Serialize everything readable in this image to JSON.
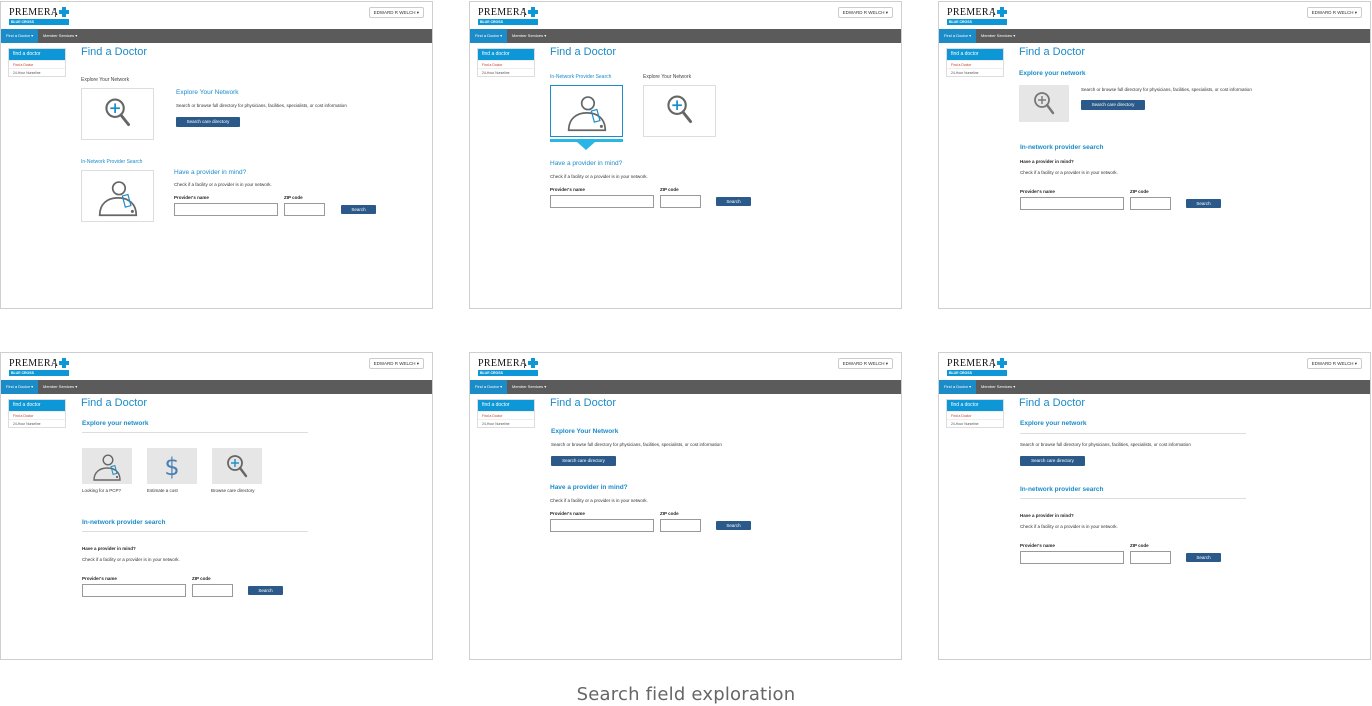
{
  "common": {
    "logo_word": "PREMERA",
    "logo_sub": "BLUE CROSS",
    "user_menu": "EDWARD R WELCH ▾",
    "nav_find_doctor": "Find a Doctor ▾",
    "nav_member_services": "Member Services ▾",
    "side_head": "find a doctor",
    "side_sub_1": "Find a Doctor",
    "side_sub_2": "24-Hour Nurseline",
    "page_title": "Find a Doctor",
    "provider_label": "Provider's name",
    "zip_label": "ZIP code",
    "search_button": "Search",
    "care_dir_button": "Search care directory",
    "have_provider": "Have a provider in mind?",
    "check_text": "Check if a facility or a provider is in your network.",
    "browse_text": "Search or browse full directory for physicians, facilities, specialists, or cost information"
  },
  "frame0": {
    "explore_label": "Explore Your Network",
    "explore_heading": "Explore Your Network",
    "innetwork_label": "In-Network Provider Search"
  },
  "frame1": {
    "innetwork_label": "In-Network Provider Search",
    "explore_label": "Explore Your Network"
  },
  "frame2": {
    "explore_heading": "Explore your network",
    "innetwork_heading": "In-network provider search"
  },
  "frame3": {
    "explore_heading": "Explore your network",
    "tile1_label": "Looking for a PCP?",
    "tile2_label": "Estimate a cost",
    "tile3_label": "Browse care directory",
    "innetwork_heading": "In-network provider search"
  },
  "frame4": {
    "explore_heading": "Explore Your Network"
  },
  "frame5": {
    "explore_heading": "Explore your network",
    "innetwork_heading": "In-network provider search"
  },
  "caption": "Search field exploration",
  "colors": {
    "accent_blue": "#1b8cc8",
    "button_navy": "#2b5a8a",
    "nav_grey": "#5b5b5b",
    "select_cyan": "#29b6e6"
  }
}
